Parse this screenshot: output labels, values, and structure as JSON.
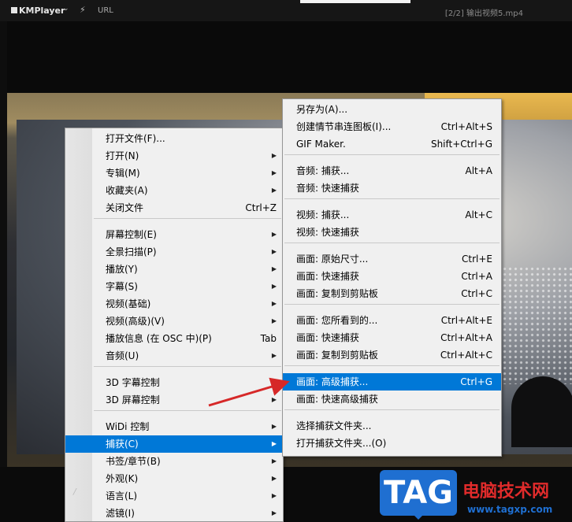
{
  "titlebar": {
    "app_name": "KMPlayer",
    "url_label": "URL",
    "file_title": "[2/2] 输出视频5.mp4"
  },
  "main_menu": {
    "items": [
      {
        "label": "打开文件(F)...",
        "shortcut": "",
        "submenu": false
      },
      {
        "label": "打开(N)",
        "shortcut": "",
        "submenu": true
      },
      {
        "label": "专辑(M)",
        "shortcut": "",
        "submenu": true
      },
      {
        "label": "收藏夹(A)",
        "shortcut": "",
        "submenu": true
      },
      {
        "label": "关闭文件",
        "shortcut": "Ctrl+Z",
        "submenu": false
      },
      {
        "label": "屏幕控制(E)",
        "shortcut": "",
        "submenu": true
      },
      {
        "label": "全景扫描(P)",
        "shortcut": "",
        "submenu": true
      },
      {
        "label": "播放(Y)",
        "shortcut": "",
        "submenu": true
      },
      {
        "label": "字幕(S)",
        "shortcut": "",
        "submenu": true
      },
      {
        "label": "视频(基础)",
        "shortcut": "",
        "submenu": true
      },
      {
        "label": "视频(高级)(V)",
        "shortcut": "",
        "submenu": true
      },
      {
        "label": "播放信息 (在 OSC 中)(P)",
        "shortcut": "Tab",
        "submenu": false
      },
      {
        "label": "音频(U)",
        "shortcut": "",
        "submenu": true
      },
      {
        "label": "3D 字幕控制",
        "shortcut": "",
        "submenu": true
      },
      {
        "label": "3D 屏幕控制",
        "shortcut": "",
        "submenu": true
      },
      {
        "label": "WiDi 控制",
        "shortcut": "",
        "submenu": true
      },
      {
        "label": "捕获(C)",
        "shortcut": "",
        "submenu": true
      },
      {
        "label": "书签/章节(B)",
        "shortcut": "",
        "submenu": true
      },
      {
        "label": "外观(K)",
        "shortcut": "",
        "submenu": true
      },
      {
        "label": "语言(L)",
        "shortcut": "",
        "submenu": true
      },
      {
        "label": "滤镜(I)",
        "shortcut": "",
        "submenu": true
      }
    ]
  },
  "capture_menu": {
    "items": [
      {
        "label": "另存为(A)...",
        "shortcut": ""
      },
      {
        "label": "创建情节串连图板(I)...",
        "shortcut": "Ctrl+Alt+S"
      },
      {
        "label": "GIF Maker.",
        "shortcut": "Shift+Ctrl+G"
      },
      {
        "label": "音频: 捕获...",
        "shortcut": "Alt+A"
      },
      {
        "label": "音频: 快速捕获",
        "shortcut": ""
      },
      {
        "label": "视频: 捕获...",
        "shortcut": "Alt+C"
      },
      {
        "label": "视频: 快速捕获",
        "shortcut": ""
      },
      {
        "label": "画面: 原始尺寸...",
        "shortcut": "Ctrl+E"
      },
      {
        "label": "画面: 快速捕获",
        "shortcut": "Ctrl+A"
      },
      {
        "label": "画面: 复制到剪贴板",
        "shortcut": "Ctrl+C"
      },
      {
        "label": "画面: 您所看到的...",
        "shortcut": "Ctrl+Alt+E"
      },
      {
        "label": "画面: 快速捕获",
        "shortcut": "Ctrl+Alt+A"
      },
      {
        "label": "画面: 复制到剪贴板",
        "shortcut": "Ctrl+Alt+C"
      },
      {
        "label": "画面: 高级捕获...",
        "shortcut": "Ctrl+G"
      },
      {
        "label": "画面: 快速高级捕获",
        "shortcut": ""
      },
      {
        "label": "选择捕获文件夹...",
        "shortcut": ""
      },
      {
        "label": "打开捕获文件夹...(O)",
        "shortcut": ""
      }
    ]
  },
  "watermark": {
    "badge": "TAG",
    "brand": "电脑技术网",
    "site": "www.tagxp.com"
  },
  "colors": {
    "selection": "#0078d7",
    "arrow": "#d62828",
    "badge": "#1f6fd1",
    "brand": "#e02b2b"
  }
}
